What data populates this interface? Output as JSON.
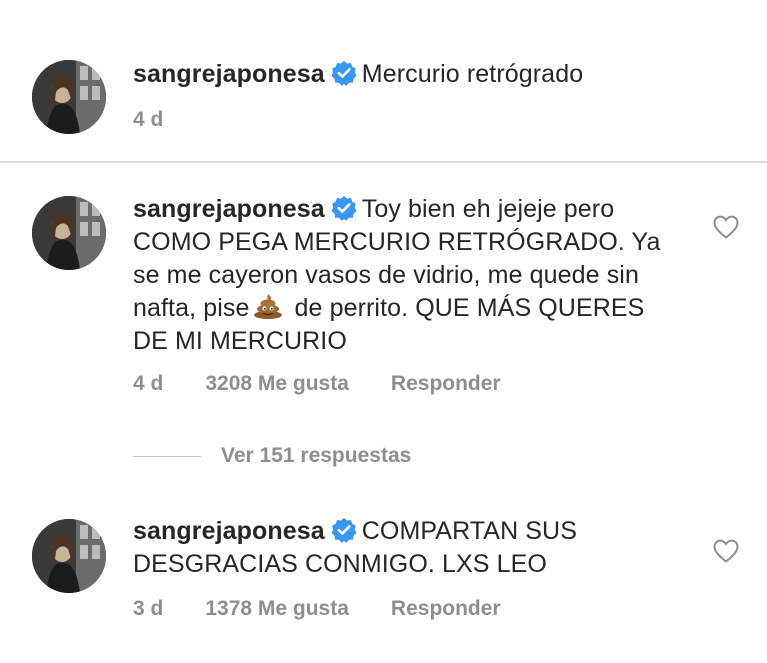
{
  "comments": [
    {
      "username": "sangrejaponesa",
      "text": "Mercurio retrógrado",
      "time": "4 d"
    },
    {
      "username": "sangrejaponesa",
      "text_before_emoji": "Toy bien eh jejeje pero COMO PEGA MERCURIO RETRÓGRADO. Ya se me cayeron vasos de vidrio, me quede sin nafta, pise",
      "emoji": "pile-of-poo",
      "text_after_emoji": "de perrito. QUE MÁS QUERES DE MI MERCURIO",
      "time": "4 d",
      "likes": "3208 Me gusta",
      "reply_label": "Responder",
      "view_replies": "Ver 151 respuestas"
    },
    {
      "username": "sangrejaponesa",
      "text": "COMPARTAN SUS DESGRACIAS CONMIGO. LXS LEO",
      "time": "3 d",
      "likes": "1378 Me gusta",
      "reply_label": "Responder"
    }
  ],
  "colors": {
    "verified_badge": "#3897f0",
    "meta_text": "#8e8e8e",
    "divider": "#dbdbdb"
  },
  "icons": [
    "verified-badge-icon",
    "heart-icon",
    "pile-of-poo-emoji"
  ]
}
